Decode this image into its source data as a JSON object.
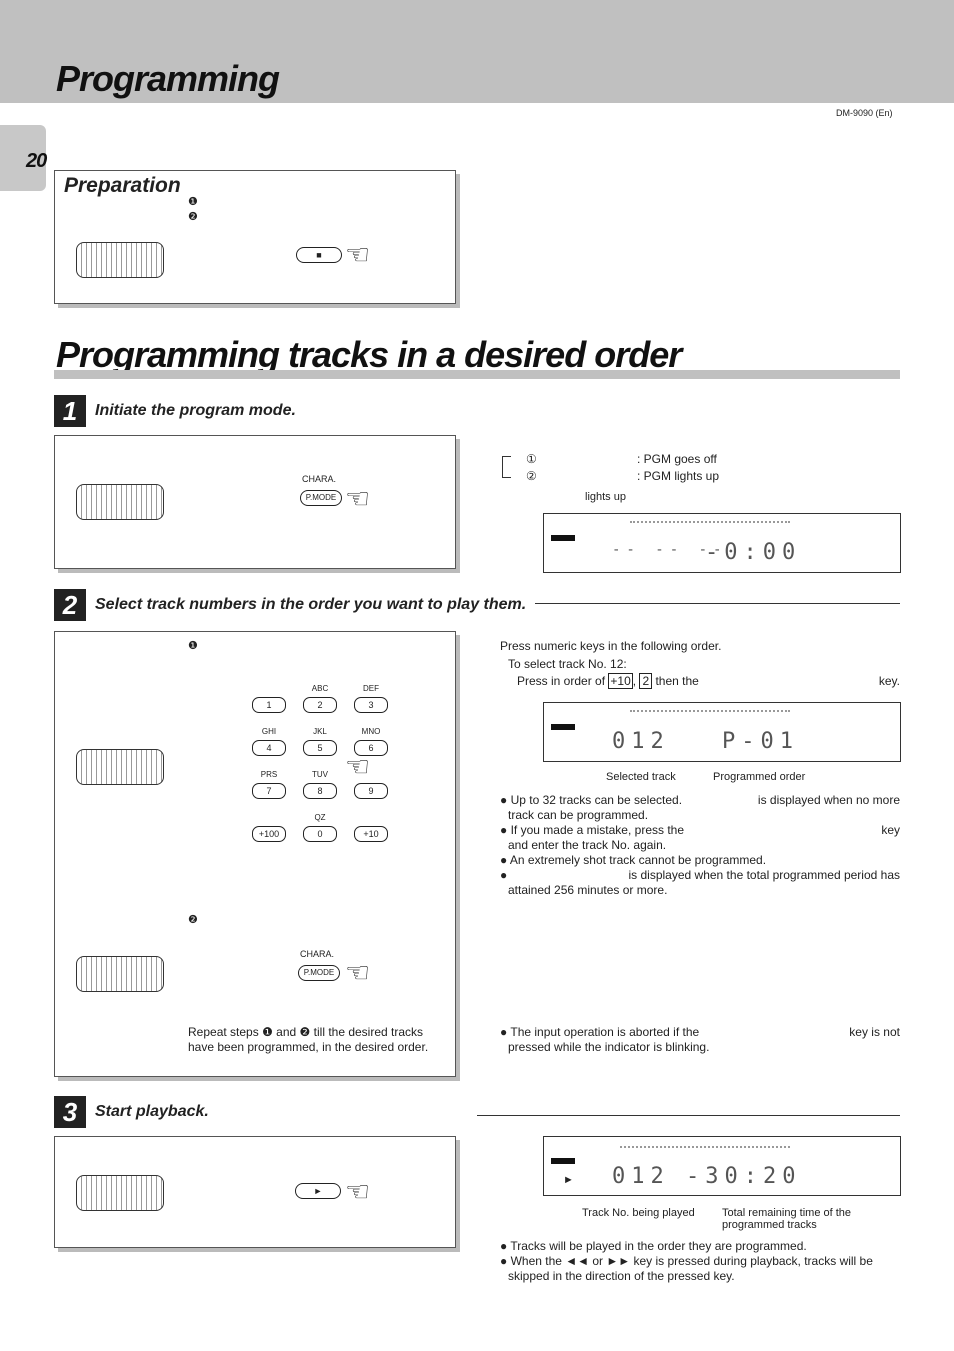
{
  "header": {
    "title": "Programming",
    "page_number": "20",
    "model": "DM-9090 (En)"
  },
  "preparation": {
    "heading": "Preparation",
    "bullet1": "❶",
    "bullet2": "❷",
    "stop_key": "■"
  },
  "section_title": "Programming tracks in a desired order",
  "step1": {
    "number": "1",
    "heading": "Initiate the program mode.",
    "chara_label": "CHARA.",
    "pmode_label": "P.MODE",
    "toggle1_num": "①",
    "toggle1_text": ": PGM goes off",
    "toggle2_num": "②",
    "toggle2_text": ": PGM lights up",
    "lights_up": "lights up",
    "display": {
      "track": "-- -- --",
      "time": "-0:00"
    }
  },
  "step2": {
    "number": "2",
    "heading": "Select track numbers in the order you want to play them.",
    "bullet1": "❶",
    "bullet2": "❷",
    "keys": [
      {
        "label": "1",
        "sub": ""
      },
      {
        "label": "2",
        "sub": "ABC"
      },
      {
        "label": "3",
        "sub": "DEF"
      },
      {
        "label": "4",
        "sub": "GHI"
      },
      {
        "label": "5",
        "sub": "JKL"
      },
      {
        "label": "6",
        "sub": "MNO"
      },
      {
        "label": "7",
        "sub": "PRS"
      },
      {
        "label": "8",
        "sub": "TUV"
      },
      {
        "label": "9",
        "sub": ""
      },
      {
        "label": "+100",
        "sub": ""
      },
      {
        "label": "0",
        "sub": "QZ"
      },
      {
        "label": "+10",
        "sub": ""
      }
    ],
    "chara_label": "CHARA.",
    "pmode_label": "P.MODE",
    "repeat_text_1": "Repeat steps",
    "repeat_b1": "❶",
    "repeat_and": "and",
    "repeat_b2": "❷",
    "repeat_text_2": "till the desired tracks",
    "repeat_text_3": "have been programmed, in the desired order.",
    "instr1": "Press numeric keys in the following order.",
    "instr2": "To select track No. 12:",
    "instr3": "Press in order of",
    "key_plus10": "+10",
    "comma": ",",
    "key_2": "2",
    "instr4": "then the",
    "instr5": "key.",
    "display": {
      "track": "012",
      "order": "P-01"
    },
    "selected_track": "Selected track",
    "programmed_order": "Programmed order",
    "notes": [
      "Up to 32 tracks can be selected.",
      "is displayed when no more",
      "track can be programmed.",
      "If you made a mistake, press the",
      "key",
      "and enter the track No. again.",
      "An extremely shot track cannot be programmed.",
      "is displayed when the total programmed period has",
      "attained 256 minutes or more."
    ],
    "abort_note_1": "The input operation is aborted if the",
    "abort_note_2": "key is not",
    "abort_note_3": "pressed while the indicator is blinking."
  },
  "step3": {
    "number": "3",
    "heading": "Start playback.",
    "play_key": "►",
    "display": {
      "play": "►",
      "track": "012",
      "time": "-30:20"
    },
    "track_label": "Track No. being played",
    "time_label_1": "Total remaining time of the",
    "time_label_2": "programmed tracks",
    "notes": [
      "Tracks will be played in the order they are programmed.",
      "When the ◄◄ or ►► key is pressed during playback, tracks will be",
      "skipped in the direction of the pressed key."
    ]
  }
}
